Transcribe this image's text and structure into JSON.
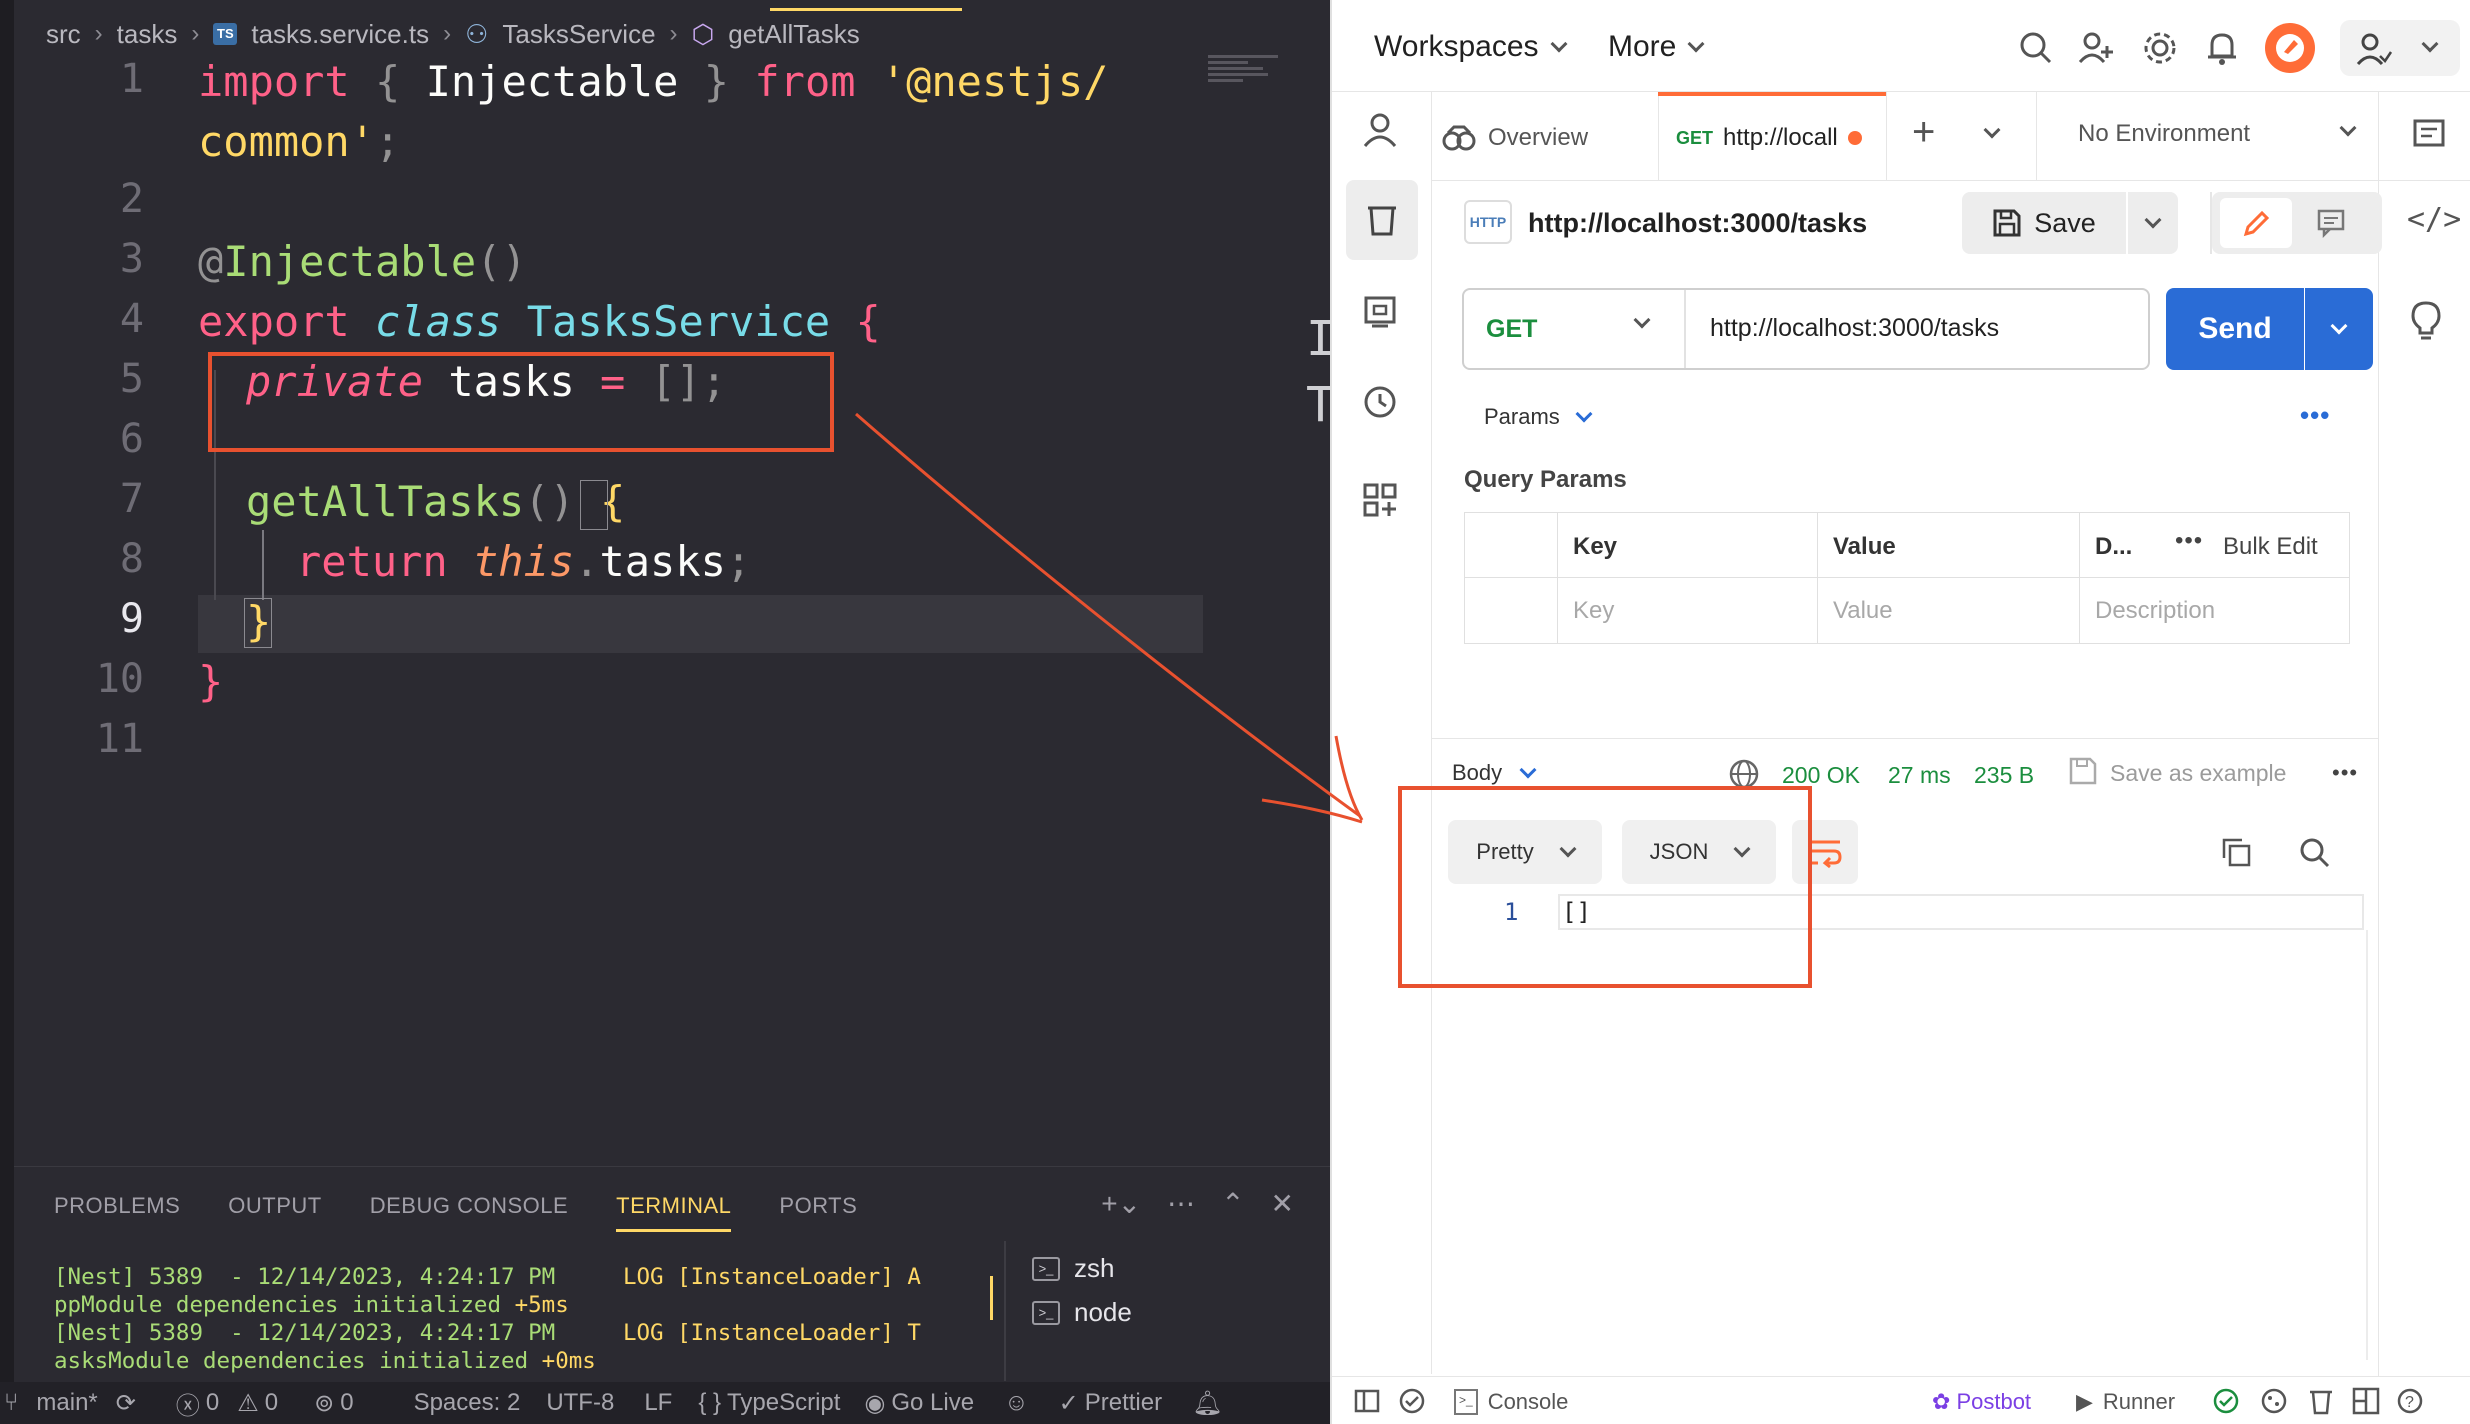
{
  "editor": {
    "breadcrumb": {
      "folder1": "src",
      "folder2": "tasks",
      "file_badge": "TS",
      "file": "tasks.service.ts",
      "class_name": "TasksService",
      "method_name": "getAllTasks"
    },
    "line_numbers": [
      "1",
      "2",
      "3",
      "4",
      "5",
      "6",
      "7",
      "8",
      "9",
      "10",
      "11"
    ],
    "code": {
      "l1_import": "import",
      "l1_brace_open": "{",
      "l1_name": "Injectable",
      "l1_brace_close": "}",
      "l1_from": "from",
      "l1_string_a": "'@nestjs/",
      "l1_string_b": "common'",
      "l1_semi": ";",
      "l3_at": "@",
      "l3_decorator": "Injectable",
      "l3_parens": "()",
      "l4_export": "export",
      "l4_class": "class",
      "l4_name": "TasksService",
      "l4_brace": "{",
      "l5_private": "private",
      "l5_name": "tasks",
      "l5_eq": "=",
      "l5_value": "[]",
      "l5_semi": ";",
      "l7_method": "getAllTasks",
      "l7_parens": "()",
      "l7_brace": "{",
      "l8_return": "return",
      "l8_this": "this",
      "l8_dot": ".",
      "l8_prop": "tasks",
      "l8_semi": ";",
      "l9_brace": "}",
      "l10_brace": "}"
    },
    "panel": {
      "tabs": [
        "PROBLEMS",
        "OUTPUT",
        "DEBUG CONSOLE",
        "TERMINAL",
        "PORTS"
      ],
      "active_tab": "TERMINAL",
      "terminal_lines": [
        {
          "a": "[Nest] 5389  - 12/14/2023, 4:24:17 PM     ",
          "b": "LOG ",
          "c": "[InstanceLoader] A"
        },
        {
          "a": "ppModule dependencies initialized ",
          "b": "+5ms",
          "c": ""
        },
        {
          "a": "[Nest] 5389  - 12/14/2023, 4:24:17 PM     ",
          "b": "LOG ",
          "c": "[InstanceLoader] T"
        },
        {
          "a": "asksModule dependencies initialized ",
          "b": "+0ms",
          "c": ""
        }
      ],
      "shells": [
        "zsh",
        "node"
      ]
    },
    "status_bar": {
      "branch": "main*",
      "errors": "0",
      "warnings": "0",
      "ports": "0",
      "spaces": "Spaces: 2",
      "encoding": "UTF-8",
      "eol": "LF",
      "language": "TypeScript",
      "go_live": "Go Live",
      "prettier": "Prettier"
    }
  },
  "postman": {
    "header": {
      "workspaces": "Workspaces",
      "more": "More"
    },
    "tabs": {
      "overview": "Overview",
      "request_method": "GET",
      "request_label": "http://locall",
      "environment": "No Environment"
    },
    "request": {
      "title": "http://localhost:3000/tasks",
      "save": "Save",
      "method": "GET",
      "url": "http://localhost:3000/tasks",
      "send": "Send",
      "params_tab": "Params",
      "query_params": "Query Params",
      "table_headers": [
        "Key",
        "Value",
        "D...",
        "Bulk Edit"
      ],
      "placeholders": [
        "Key",
        "Value",
        "Description"
      ]
    },
    "response": {
      "body_tab": "Body",
      "status": "200 OK",
      "time": "27 ms",
      "size": "235 B",
      "save_example": "Save as example",
      "format": "Pretty",
      "language": "JSON",
      "line_number": "1",
      "content": "[]"
    },
    "bottom_bar": {
      "console": "Console",
      "postbot": "Postbot",
      "runner": "Runner"
    },
    "colors": {
      "send_button": "#2a6cd6",
      "accent_orange": "#ff6c37",
      "status_green": "#1b8e3e"
    }
  },
  "annotation": {
    "color": "#e8512f"
  }
}
